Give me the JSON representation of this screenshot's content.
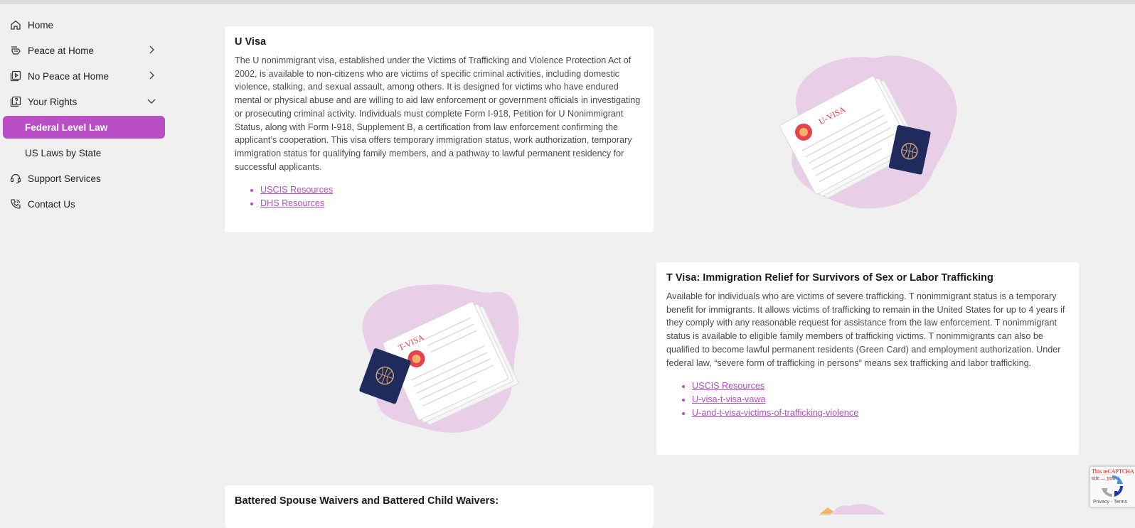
{
  "sidebar": {
    "items": [
      {
        "label": "Home",
        "icon": "home-icon"
      },
      {
        "label": "Peace at Home",
        "icon": "peace-icon"
      },
      {
        "label": "No Peace at Home",
        "icon": "media-icon"
      },
      {
        "label": "Your Rights",
        "icon": "rights-icon"
      },
      {
        "label": "Federal Level Law"
      },
      {
        "label": "US Laws by State"
      },
      {
        "label": "Support Services",
        "icon": "headset-icon"
      },
      {
        "label": "Contact Us",
        "icon": "phone-icon"
      }
    ]
  },
  "cards": {
    "u_visa": {
      "title": "U Visa",
      "body": "The U nonimmigrant visa, established under the Victims of Trafficking and Violence Protection Act of 2002, is available to non-citizens who are victims of specific criminal activities, including domestic violence, stalking, and sexual assault, among others. It is designed for victims who have endured mental or physical abuse and are willing to aid law enforcement or government officials in investigating or prosecuting criminal activity. Individuals must complete Form I-918, Petition for U Nonimmigrant Status, along with Form I-918, Supplement B, a certification from law enforcement confirming the applicant’s cooperation. This visa offers temporary immigration status, work authorization, temporary immigration status for qualifying family members, and a pathway to lawful permanent residency for successful applicants.",
      "links": [
        "USCIS Resources",
        "DHS Resources"
      ]
    },
    "t_visa": {
      "title": "T Visa: Immigration Relief for Survivors of Sex or Labor Trafficking",
      "body": "Available for individuals who are victims of severe trafficking. T nonimmigrant status is a temporary benefit for immigrants. It allows victims of trafficking to remain in the United States for up to 4 years if they comply with any reasonable request for assistance from the law enforcement. T nonimmigrant status is available to eligible family members of trafficking victims. T nonimmigrants can also be qualified to become lawful permanent residents (Green Card) and employment authorization. Under federal law, “severe form of trafficking in persons” means sex trafficking and labor trafficking.",
      "links": [
        "USCIS Resources",
        "U-visa-t-visa-vawa",
        "U-and-t-visa-victims-of-trafficking-violence"
      ]
    },
    "battered": {
      "title": "Battered Spouse Waivers and Battered Child Waivers:"
    }
  },
  "illustrations": {
    "u_visa_stamp": "U-VISA",
    "t_visa_stamp": "T-VISA"
  },
  "recaptcha": {
    "warning": "This reCAPTCHA site ... you a",
    "terms": "Privacy - Terms"
  },
  "colors": {
    "accent": "#b94ec7",
    "link": "#b34fc2",
    "blob": "#e8cfe7",
    "passport": "#1f2b5c",
    "stamp": "#e8424f"
  }
}
